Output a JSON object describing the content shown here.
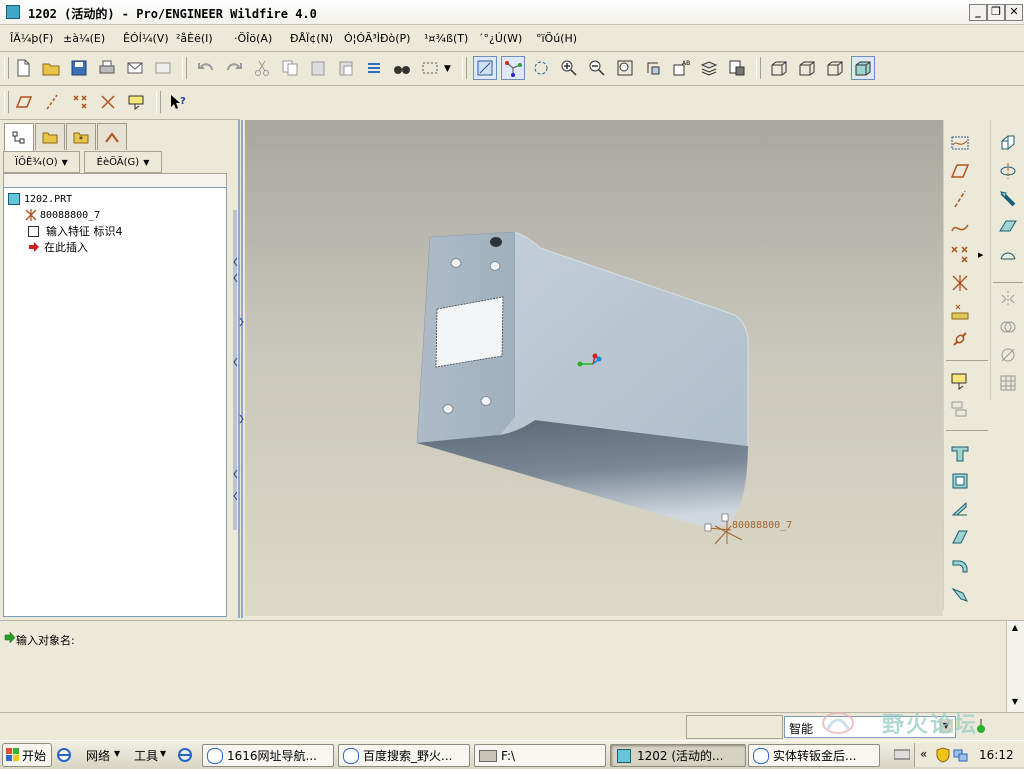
{
  "window": {
    "title": "1202 (活动的) - Pro/ENGINEER Wildfire 4.0",
    "minimize_glyph": "_",
    "maximize_glyph": "❐",
    "close_glyph": "✕"
  },
  "menu": [
    "ÎÄ¼þ(F)",
    "±à¼­(E)",
    "ÊÓÍ¼(V)",
    "²åÈë(I)",
    "·ÖÎö(A)",
    "ÐÅÏ¢(N)",
    "Ó¦ÓÃ³ÌÐò(P)",
    "¹¤¾ß(T)",
    "´°¿Ú(W)",
    "°ïÖú(H)"
  ],
  "model_tree": {
    "show_menu": "ÏÔÊ¾(O)",
    "settings_menu": "ÉèÖÃ(G)",
    "items": [
      {
        "label": "1202.PRT",
        "icon": "part-icon"
      },
      {
        "label": "80088800_7",
        "icon": "csys-icon"
      },
      {
        "label": "输入特征 标识4",
        "icon": "import-feature-icon"
      },
      {
        "label": "在此插入",
        "icon": "insert-here-arrow-icon"
      }
    ]
  },
  "viewport": {
    "csys_label": "80088800_7"
  },
  "message": {
    "prompt": "输入对象名:"
  },
  "status": {
    "filter": "智能",
    "watermark": "野火论坛"
  },
  "taskbar": {
    "start": "开始",
    "network": "网络",
    "tools": "工具",
    "tasks": [
      {
        "label": "1616网址导航..."
      },
      {
        "label": "百度搜索_野火..."
      },
      {
        "label": "F:\\"
      },
      {
        "label": "1202 (活动的..."
      },
      {
        "label": "实体转钣金后..."
      }
    ],
    "expand": "«",
    "time": "16:12"
  },
  "colors": {
    "part_surface": "#b4c3cf",
    "viewport_top": "#a9a79f",
    "viewport_bottom": "#ddd9c7",
    "csys_color": "#a0642e"
  }
}
